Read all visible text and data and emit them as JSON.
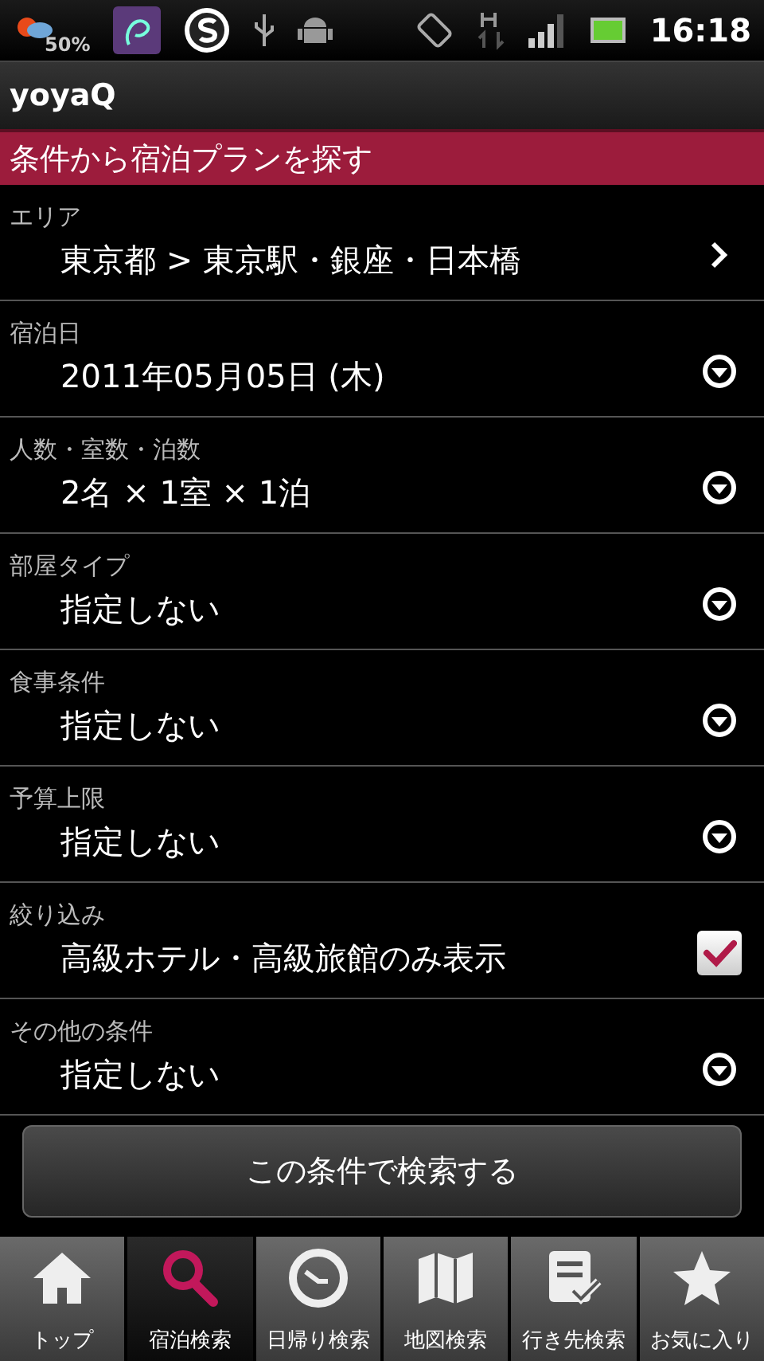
{
  "status_bar": {
    "weather_percent": "50%",
    "time": "16:18"
  },
  "app_bar": {
    "title": "yoyaQ"
  },
  "section_header": "条件から宿泊プランを探す",
  "rows": [
    {
      "kind": "link",
      "label": "エリア",
      "value": "東京都 > 東京駅・銀座・日本橋"
    },
    {
      "kind": "dropdown",
      "label": "宿泊日",
      "value": "2011年05月05日 (木)"
    },
    {
      "kind": "dropdown",
      "label": "人数・室数・泊数",
      "value": "2名 × 1室 × 1泊"
    },
    {
      "kind": "dropdown",
      "label": "部屋タイプ",
      "value": "指定しない"
    },
    {
      "kind": "dropdown",
      "label": "食事条件",
      "value": "指定しない"
    },
    {
      "kind": "dropdown",
      "label": "予算上限",
      "value": "指定しない"
    },
    {
      "kind": "checkbox",
      "label": "絞り込み",
      "value": "高級ホテル・高級旅館のみ表示",
      "checked": true
    },
    {
      "kind": "dropdown",
      "label": "その他の条件",
      "value": "指定しない"
    }
  ],
  "search_button": "この条件で検索する",
  "tabs": [
    {
      "kind": "home",
      "label": "トップ",
      "selected": false
    },
    {
      "kind": "search",
      "label": "宿泊検索",
      "selected": true
    },
    {
      "kind": "clock",
      "label": "日帰り検索",
      "selected": false
    },
    {
      "kind": "map",
      "label": "地図検索",
      "selected": false
    },
    {
      "kind": "list",
      "label": "行き先検索",
      "selected": false
    },
    {
      "kind": "star",
      "label": "お気に入り",
      "selected": false
    }
  ]
}
